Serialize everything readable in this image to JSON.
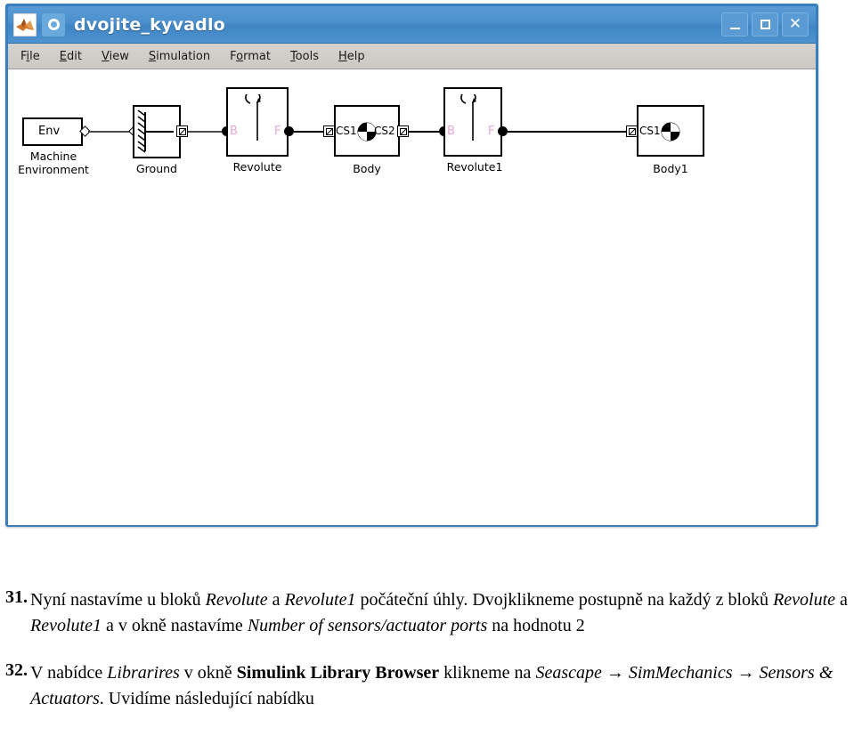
{
  "window": {
    "title": "dvojite_kyvadlo",
    "icons": {
      "app_icon": "matlab-membrane-icon",
      "model_icon": "simulink-ring-icon"
    },
    "controls": {
      "minimize": "_",
      "maximize": "□",
      "close": "✕"
    },
    "menubar": [
      {
        "label": "File",
        "mnemonic": "i"
      },
      {
        "label": "Edit",
        "mnemonic": "E"
      },
      {
        "label": "View",
        "mnemonic": "V"
      },
      {
        "label": "Simulation",
        "mnemonic": "S"
      },
      {
        "label": "Format",
        "mnemonic": "o"
      },
      {
        "label": "Tools",
        "mnemonic": "T"
      },
      {
        "label": "Help",
        "mnemonic": "H"
      }
    ]
  },
  "diagram": {
    "blocks": [
      {
        "id": "machine-environment",
        "inner": "Env",
        "label": "Machine\nEnvironment"
      },
      {
        "id": "ground",
        "inner": "",
        "label": "Ground"
      },
      {
        "id": "revolute",
        "inner": "",
        "label": "Revolute",
        "port_left": "B",
        "port_right": "F"
      },
      {
        "id": "body",
        "inner_left": "CS1",
        "inner_right": "CS2",
        "label": "Body"
      },
      {
        "id": "revolute1",
        "inner": "",
        "label": "Revolute1",
        "port_left": "B",
        "port_right": "F"
      },
      {
        "id": "body1",
        "inner_left": "CS1",
        "label": "Body1"
      }
    ],
    "colors": {
      "port_label": "#e8a9d8",
      "wire": "#4a4a4a",
      "block_border": "#000000"
    }
  },
  "instructions": [
    {
      "number": "31.",
      "segments": [
        {
          "t": "Nyní nastavíme u bloků ",
          "s": "n"
        },
        {
          "t": "Revolute",
          "s": "i"
        },
        {
          "t": " a ",
          "s": "n"
        },
        {
          "t": "Revolute1",
          "s": "i"
        },
        {
          "t": " počáteční úhly. Dvojklikneme postupně na každý z bloků ",
          "s": "n"
        },
        {
          "t": "Revolute",
          "s": "i"
        },
        {
          "t": " a ",
          "s": "n"
        },
        {
          "t": "Revolute1",
          "s": "i"
        },
        {
          "t": " a v okně nastavíme ",
          "s": "n"
        },
        {
          "t": "Number of sensors/actuator ports",
          "s": "i"
        },
        {
          "t": " na hodnotu 2",
          "s": "n"
        }
      ]
    },
    {
      "number": "32.",
      "segments": [
        {
          "t": "V nabídce ",
          "s": "n"
        },
        {
          "t": "Librarires",
          "s": "i"
        },
        {
          "t": " v okně ",
          "s": "n"
        },
        {
          "t": "Simulink Library Browser",
          "s": "b"
        },
        {
          "t": " klikneme na ",
          "s": "n"
        },
        {
          "t": "Seascape → SimMechanics → Sensors & Actuators",
          "s": "i"
        },
        {
          "t": ". Uvidíme následující nabídku",
          "s": "n"
        }
      ]
    }
  ]
}
